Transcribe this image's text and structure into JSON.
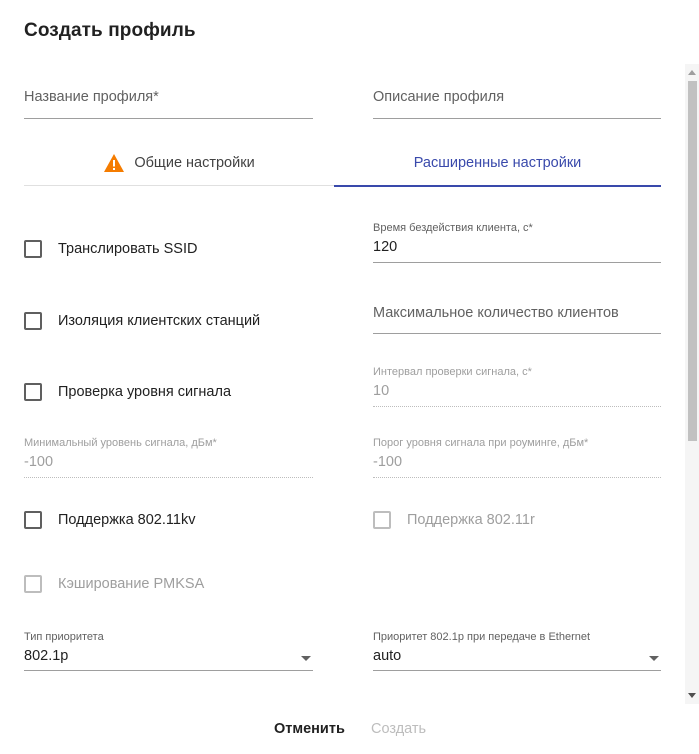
{
  "dialog": {
    "title": "Создать профиль"
  },
  "fields": {
    "profile_name_placeholder": "Название профиля*",
    "profile_description_placeholder": "Описание профиля"
  },
  "tabs": [
    {
      "label": "Общие настройки",
      "icon": "warning-icon",
      "active": false
    },
    {
      "label": "Расширенные настройки",
      "active": true
    }
  ],
  "advanced": {
    "broadcast_ssid": {
      "label": "Транслировать SSID",
      "checked": false
    },
    "client_isolation": {
      "label": "Изоляция клиентских станций",
      "checked": false
    },
    "signal_check": {
      "label": "Проверка уровня сигнала",
      "checked": false
    },
    "support_80211kv": {
      "label": "Поддержка 802.11kv",
      "checked": false
    },
    "support_80211r": {
      "label": "Поддержка 802.11r",
      "checked": false,
      "disabled": true
    },
    "pmksa_caching": {
      "label": "Кэширование PMKSA",
      "checked": false,
      "disabled": true
    },
    "client_idle_time": {
      "label": "Время бездействия клиента, с*",
      "value": "120"
    },
    "max_clients": {
      "placeholder": "Максимальное количество клиентов"
    },
    "signal_check_interval": {
      "label": "Интервал проверки сигнала, с*",
      "value": "10",
      "disabled": true
    },
    "min_signal_level": {
      "label": "Минимальный уровень сигнала, дБм*",
      "value": "-100",
      "disabled": true
    },
    "roaming_signal_threshold": {
      "label": "Порог уровня сигнала при роуминге, дБм*",
      "value": "-100",
      "disabled": true
    },
    "priority_type": {
      "label": "Тип приоритета",
      "value": "802.1p"
    },
    "priority_8021p_ethernet": {
      "label": "Приоритет 802.1p при передаче в Ethernet",
      "value": "auto"
    }
  },
  "actions": {
    "cancel_label": "Отменить",
    "create_label": "Создать"
  },
  "colors": {
    "accent": "#3949ab",
    "warning": "#f57c00"
  }
}
